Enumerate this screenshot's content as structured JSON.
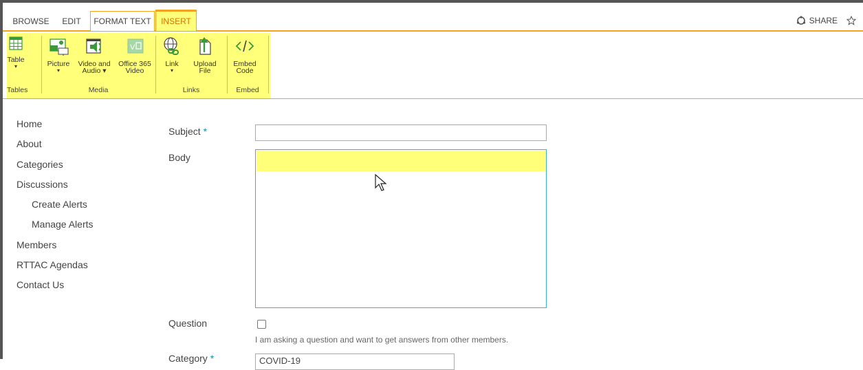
{
  "tabs": {
    "browse": "BROWSE",
    "edit": "EDIT",
    "format_text": "FORMAT TEXT",
    "insert": "INSERT"
  },
  "share_label": "SHARE",
  "ribbon": {
    "table": {
      "line1": "Table",
      "arrow": "▾"
    },
    "picture": {
      "line1": "Picture",
      "arrow": "▾"
    },
    "video_audio": {
      "line1": "Video and",
      "line2": "Audio ▾"
    },
    "office365": {
      "line1": "Office 365",
      "line2": "Video"
    },
    "link": {
      "line1": "Link",
      "arrow": "▾"
    },
    "upload": {
      "line1": "Upload",
      "line2": "File"
    },
    "embed": {
      "line1": "Embed",
      "line2": "Code"
    },
    "groups": {
      "tables": "Tables",
      "media": "Media",
      "links": "Links",
      "embed": "Embed"
    }
  },
  "nav": {
    "home": "Home",
    "about": "About",
    "categories": "Categories",
    "discussions": "Discussions",
    "create_alerts": "Create Alerts",
    "manage_alerts": "Manage Alerts",
    "members": "Members",
    "rttac_agendas": "RTTAC Agendas",
    "contact_us": "Contact Us"
  },
  "form": {
    "subject_label": "Subject",
    "required_mark": " *",
    "subject_value": "",
    "body_label": "Body",
    "question_label": "Question",
    "question_hint": "I am asking a question and want to get answers from other members.",
    "category_label": "Category",
    "category_value": "COVID-19"
  },
  "colors": {
    "accent": "#f6a21b",
    "highlight": "#ffff7a",
    "ribbon_icon": "#3a9a3a",
    "required": "#0d8fad"
  }
}
